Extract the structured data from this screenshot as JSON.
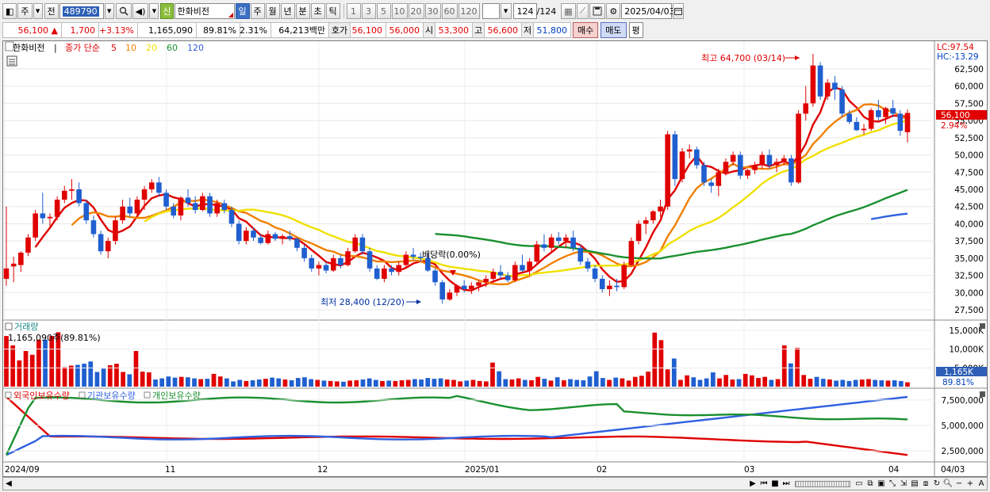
{
  "toolbar": {
    "market_label": "주",
    "prev_label": "전",
    "code_value": "489790",
    "name_badge": "신",
    "stock_name": "한화비전",
    "periods": [
      "일",
      "주",
      "월",
      "년",
      "분",
      "초",
      "틱"
    ],
    "active_period": "일",
    "multipliers": [
      "1",
      "3",
      "5",
      "10",
      "20",
      "30",
      "60",
      "120"
    ],
    "count_value": "124",
    "count_total": "/124",
    "date_value": "2025/04/03"
  },
  "quote": {
    "price": "56,100",
    "arrow": "▲",
    "change": "1,700",
    "change_pct": "+3.13%",
    "volume": "1,165,090",
    "vol_ratio": "89.81%",
    "turnover": "2.31%",
    "amount": "64,213백만",
    "hoga_label": "호가",
    "ask": "56,100",
    "bid": "56,000",
    "open_label": "시",
    "open": "53,300",
    "high_label": "고",
    "high": "56,600",
    "low_label": "저",
    "low": "51,800",
    "buy_label": "매수",
    "sell_label": "매도",
    "eval_label": "평"
  },
  "chart": {
    "legend_name": "한화비전",
    "legend_price": "종가 단순",
    "ma_periods": [
      "5",
      "10",
      "20",
      "60",
      "120"
    ],
    "ma_colors": [
      "#e00000",
      "#f08000",
      "#f0e000",
      "#1a9030",
      "#3060e0"
    ],
    "lc": "LC:97.54",
    "hc": "HC:-13.29",
    "price_tag": "56,100",
    "pct_tag": "2.94%",
    "y_ticks": [
      "62,500",
      "60,000",
      "57,500",
      "55,000",
      "52,500",
      "50,000",
      "47,500",
      "45,000",
      "42,500",
      "40,000",
      "37,500",
      "35,000",
      "32,500",
      "30,000",
      "27,500"
    ],
    "high_note": "최고 64,700 (03/14)",
    "low_note": "최저 28,400 (12/20)",
    "div_note": "배당락(0.00%)",
    "vol_title": "거래량",
    "vol_info": "1,165,090주(89.81%)",
    "vol_ticks": [
      "15,000K",
      "10,000K",
      "5,000K"
    ],
    "vol_tag": "1,165K",
    "vol_pct_tag": "89.81%",
    "hold_titles": [
      "외국인보유수량",
      "기관보유수량",
      "개인보유수량"
    ],
    "hold_colors": [
      "#e00000",
      "#3060e0",
      "#1a9030"
    ],
    "hold_ticks": [
      "7,500,000",
      "5,000,000",
      "2,500,000"
    ],
    "x_labels": [
      "2024/09",
      "11",
      "12",
      "2025/01",
      "02",
      "03",
      "04"
    ],
    "x_end_label": "04/03"
  },
  "chart_data": {
    "type": "candlestick",
    "unit": "KRW",
    "ylim": [
      27500,
      64700
    ],
    "candles": [
      [
        32000,
        42500,
        31000,
        33500
      ],
      [
        33800,
        35200,
        31500,
        34200
      ],
      [
        34000,
        36000,
        33000,
        35800
      ],
      [
        35800,
        38500,
        35300,
        38000
      ],
      [
        38000,
        42000,
        37500,
        41500
      ],
      [
        41500,
        44500,
        40000,
        40800
      ],
      [
        40800,
        41500,
        39500,
        41000
      ],
      [
        41000,
        44000,
        40500,
        43500
      ],
      [
        43500,
        45500,
        43000,
        44800
      ],
      [
        44800,
        46500,
        43500,
        45000
      ],
      [
        45000,
        46000,
        42500,
        43000
      ],
      [
        43000,
        43500,
        40000,
        40500
      ],
      [
        40500,
        41200,
        38000,
        38500
      ],
      [
        38500,
        39000,
        35500,
        36000
      ],
      [
        36000,
        38000,
        35000,
        37500
      ],
      [
        37500,
        41000,
        37000,
        40500
      ],
      [
        40500,
        43500,
        40000,
        42500
      ],
      [
        42500,
        43800,
        41000,
        41500
      ],
      [
        41500,
        44000,
        41000,
        43500
      ],
      [
        43500,
        45500,
        42000,
        45000
      ],
      [
        45000,
        46500,
        44500,
        46000
      ],
      [
        46000,
        46800,
        44000,
        44500
      ],
      [
        44500,
        45000,
        42000,
        42500
      ],
      [
        42500,
        43000,
        40800,
        41200
      ],
      [
        41200,
        44000,
        40500,
        43800
      ],
      [
        43800,
        45000,
        42500,
        43000
      ],
      [
        43000,
        44000,
        41500,
        42000
      ],
      [
        42000,
        44500,
        41800,
        44000
      ],
      [
        44000,
        44500,
        41000,
        41500
      ],
      [
        41500,
        43500,
        41000,
        43000
      ],
      [
        43000,
        43500,
        41500,
        42000
      ],
      [
        42000,
        42500,
        39500,
        40000
      ],
      [
        40000,
        40500,
        37000,
        37500
      ],
      [
        37500,
        39500,
        37000,
        39000
      ],
      [
        39000,
        39500,
        37500,
        38000
      ],
      [
        38000,
        38500,
        37000,
        37200
      ],
      [
        37200,
        39000,
        37000,
        38500
      ],
      [
        38500,
        38800,
        37500,
        37800
      ],
      [
        37800,
        38500,
        37000,
        38200
      ],
      [
        38200,
        39000,
        37500,
        37800
      ],
      [
        37800,
        38000,
        36000,
        36500
      ],
      [
        36500,
        37000,
        34500,
        35000
      ],
      [
        35000,
        35500,
        33000,
        33500
      ],
      [
        33500,
        34500,
        32500,
        34000
      ],
      [
        34000,
        34500,
        32800,
        33200
      ],
      [
        33200,
        35500,
        33000,
        35000
      ],
      [
        35000,
        35500,
        33500,
        34000
      ],
      [
        34000,
        36500,
        33800,
        36000
      ],
      [
        36000,
        38500,
        35800,
        38000
      ],
      [
        38000,
        38500,
        35500,
        36000
      ],
      [
        36000,
        36500,
        33000,
        33500
      ],
      [
        33500,
        34000,
        31800,
        32000
      ],
      [
        32000,
        34000,
        31500,
        33500
      ],
      [
        33500,
        34000,
        32500,
        33000
      ],
      [
        33000,
        34500,
        32500,
        34000
      ],
      [
        34000,
        36000,
        33500,
        35500
      ],
      [
        35500,
        36500,
        34800,
        35200
      ],
      [
        35200,
        35800,
        34500,
        35000
      ],
      [
        35000,
        35500,
        33000,
        33200
      ],
      [
        33200,
        33500,
        31000,
        31500
      ],
      [
        31500,
        31800,
        28400,
        29000
      ],
      [
        29000,
        30500,
        28800,
        30000
      ],
      [
        30000,
        31200,
        29500,
        31000
      ],
      [
        31000,
        31800,
        30000,
        30500
      ],
      [
        30500,
        31500,
        29800,
        31000
      ],
      [
        31000,
        31800,
        30200,
        31500
      ],
      [
        31500,
        32500,
        30800,
        32000
      ],
      [
        32000,
        33500,
        31500,
        33000
      ],
      [
        33000,
        34000,
        32000,
        32500
      ],
      [
        32500,
        33000,
        31500,
        31800
      ],
      [
        31800,
        34500,
        31500,
        34000
      ],
      [
        34000,
        35500,
        33000,
        33200
      ],
      [
        33200,
        35000,
        32500,
        34500
      ],
      [
        34500,
        37500,
        34000,
        37000
      ],
      [
        37000,
        38500,
        36000,
        36500
      ],
      [
        36500,
        38500,
        35800,
        38000
      ],
      [
        38000,
        38800,
        37000,
        37500
      ],
      [
        37500,
        38500,
        36500,
        38000
      ],
      [
        38000,
        39000,
        36000,
        36500
      ],
      [
        36500,
        37000,
        34000,
        34500
      ],
      [
        34500,
        35000,
        33000,
        33500
      ],
      [
        33500,
        34000,
        31500,
        32000
      ],
      [
        32000,
        32500,
        30000,
        30500
      ],
      [
        30500,
        31800,
        29500,
        31000
      ],
      [
        31000,
        32000,
        30200,
        30800
      ],
      [
        30800,
        34500,
        30500,
        34000
      ],
      [
        34000,
        38000,
        33800,
        37500
      ],
      [
        37500,
        40500,
        37000,
        40000
      ],
      [
        40000,
        41000,
        38500,
        40500
      ],
      [
        40500,
        42000,
        40000,
        41800
      ],
      [
        41800,
        43500,
        41000,
        42500
      ],
      [
        42500,
        53500,
        42000,
        53000
      ],
      [
        53000,
        53500,
        45500,
        46500
      ],
      [
        46500,
        51000,
        46000,
        50500
      ],
      [
        50500,
        51500,
        49500,
        50800
      ],
      [
        50800,
        51200,
        48000,
        48500
      ],
      [
        48500,
        49000,
        45500,
        46000
      ],
      [
        46000,
        46500,
        44500,
        45500
      ],
      [
        45500,
        48000,
        44000,
        47500
      ],
      [
        47500,
        49500,
        47000,
        49000
      ],
      [
        49000,
        50500,
        48500,
        50000
      ],
      [
        50000,
        50500,
        46500,
        47000
      ],
      [
        47000,
        48000,
        46500,
        47800
      ],
      [
        47800,
        49000,
        47200,
        48500
      ],
      [
        48500,
        50500,
        48000,
        50000
      ],
      [
        50000,
        50800,
        48000,
        48500
      ],
      [
        48500,
        49500,
        47500,
        49000
      ],
      [
        49000,
        50000,
        48500,
        49500
      ],
      [
        49500,
        50000,
        45500,
        46000
      ],
      [
        46000,
        56500,
        45800,
        56000
      ],
      [
        56000,
        60000,
        55000,
        57500
      ],
      [
        57500,
        64700,
        57000,
        63000
      ],
      [
        63000,
        63500,
        58000,
        58500
      ],
      [
        58500,
        61000,
        58000,
        60500
      ],
      [
        60500,
        61500,
        58000,
        59500
      ],
      [
        59500,
        60000,
        55500,
        56000
      ],
      [
        56000,
        56500,
        54500,
        54800
      ],
      [
        54800,
        55500,
        53500,
        53600
      ],
      [
        53600,
        54500,
        53000,
        53800
      ],
      [
        53800,
        56800,
        53500,
        56500
      ],
      [
        56500,
        58000,
        55000,
        55500
      ],
      [
        55500,
        57000,
        54500,
        56800
      ],
      [
        56800,
        58000,
        55500,
        56000
      ],
      [
        56000,
        56500,
        52800,
        53500
      ],
      [
        53300,
        56600,
        51800,
        56100
      ]
    ],
    "volume_k": [
      13500,
      11000,
      7000,
      9500,
      8500,
      12500,
      12500,
      13500,
      14500,
      5200,
      5600,
      5800,
      6100,
      6700,
      3900,
      4800,
      5700,
      6100,
      3900,
      3300,
      9500,
      4000,
      3800,
      1900,
      2200,
      2700,
      2400,
      2600,
      2500,
      2200,
      2000,
      2100,
      3400,
      2700,
      2200,
      1400,
      1800,
      1500,
      1700,
      1900,
      2100,
      2400,
      2200,
      1900,
      1700,
      2300,
      2500,
      2000,
      1800,
      1600,
      1500,
      1400,
      1300,
      1600,
      1700,
      1900,
      2200,
      1800,
      1500,
      1600,
      1500,
      1700,
      1800,
      2000,
      1900,
      2300,
      2100,
      2200,
      1900,
      1800,
      1400,
      1600,
      1800,
      1500,
      1400,
      6400,
      4100,
      2000,
      1900,
      2200,
      1800,
      1700,
      2600,
      2100,
      1600,
      2500,
      1700,
      2000,
      1800,
      1700,
      2700,
      4100,
      2300,
      1800,
      2400,
      2200,
      1600,
      2600,
      2900,
      4000,
      14400,
      12400,
      4600,
      7500,
      1800,
      3000,
      2500,
      1800,
      2200,
      3800,
      2200,
      3100,
      1900,
      2000,
      3400,
      3000,
      2300,
      2600,
      1800,
      2000,
      11000,
      6200,
      10300,
      3100,
      2100,
      2600,
      2100,
      1900,
      1600,
      1800,
      1500,
      1800,
      1900,
      2000,
      1800,
      1700,
      1600,
      1700,
      1500,
      1165
    ],
    "holdings": {
      "foreign_start": 7800000,
      "foreign_end": 2100000,
      "institution_start": 2100000,
      "institution_end": 7800000,
      "individual_start": 2100000,
      "individual_end": 5500000
    }
  }
}
